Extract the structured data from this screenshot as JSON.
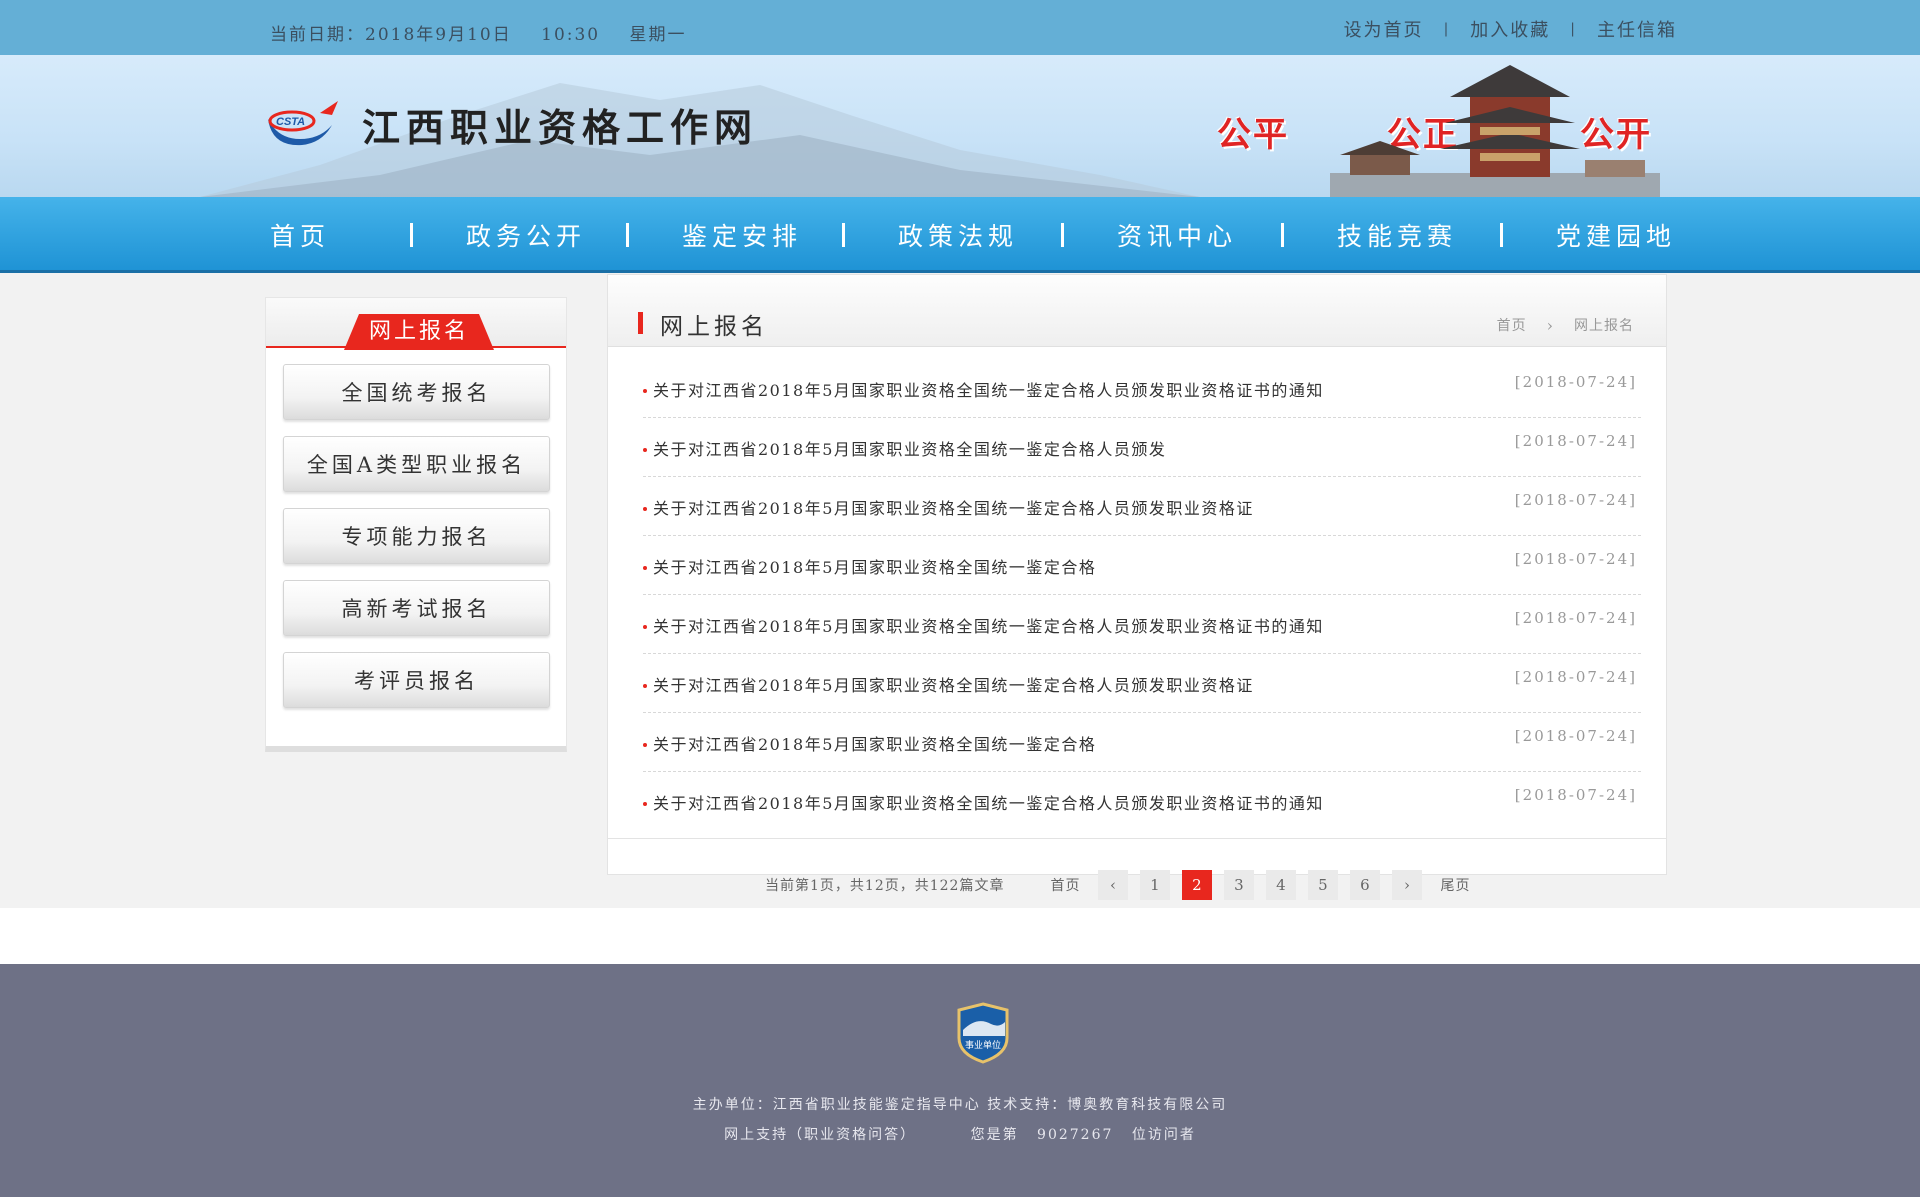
{
  "topbar": {
    "date_label": "当前日期：2018年9月10日",
    "time": "10:30",
    "weekday": "星期一",
    "links": [
      "设为首页",
      "加入收藏",
      "主任信箱"
    ]
  },
  "banner": {
    "logo_text": "CSTA",
    "site_title": "江西职业资格工作网",
    "slogans": [
      "公平",
      "公正",
      "公开"
    ]
  },
  "nav": {
    "items": [
      "首页",
      "政务公开",
      "鉴定安排",
      "政策法规",
      "资讯中心",
      "技能竞赛",
      "党建园地"
    ]
  },
  "sidebar": {
    "title": "网上报名",
    "buttons": [
      "全国统考报名",
      "全国A类型职业报名",
      "专项能力报名",
      "高新考试报名",
      "考评员报名"
    ]
  },
  "main": {
    "title": "网上报名",
    "breadcrumb": {
      "home": "首页",
      "current": "网上报名"
    },
    "news": [
      {
        "title": "关于对江西省2018年5月国家职业资格全国统一鉴定合格人员颁发职业资格证书的通知",
        "date": "[2018-07-24]"
      },
      {
        "title": "关于对江西省2018年5月国家职业资格全国统一鉴定合格人员颁发",
        "date": "[2018-07-24]"
      },
      {
        "title": "关于对江西省2018年5月国家职业资格全国统一鉴定合格人员颁发职业资格证",
        "date": "[2018-07-24]"
      },
      {
        "title": "关于对江西省2018年5月国家职业资格全国统一鉴定合格",
        "date": "[2018-07-24]"
      },
      {
        "title": "关于对江西省2018年5月国家职业资格全国统一鉴定合格人员颁发职业资格证书的通知",
        "date": "[2018-07-24]"
      },
      {
        "title": "关于对江西省2018年5月国家职业资格全国统一鉴定合格人员颁发职业资格证",
        "date": "[2018-07-24]"
      },
      {
        "title": "关于对江西省2018年5月国家职业资格全国统一鉴定合格",
        "date": "[2018-07-24]"
      },
      {
        "title": "关于对江西省2018年5月国家职业资格全国统一鉴定合格人员颁发职业资格证书的通知",
        "date": "[2018-07-24]"
      }
    ]
  },
  "pager": {
    "info": "当前第1页，共12页，共122篇文章",
    "first": "首页",
    "last": "尾页",
    "pages": [
      "1",
      "2",
      "3",
      "4",
      "5",
      "6"
    ],
    "current": "2"
  },
  "footer": {
    "badge_text": "事业单位",
    "line1": "主办单位：江西省职业技能鉴定指导中心  技术支持：博奥教育科技有限公司",
    "support": "网上支持（职业资格问答）",
    "visitor_prefix": "您是第",
    "visitor_count": "9027267",
    "visitor_suffix": "位访问者"
  },
  "colors": {
    "accent_red": "#e8271e",
    "nav_blue": "#1f93d5",
    "topbar_blue": "#64afd6",
    "footer_gray": "#6e7186"
  }
}
